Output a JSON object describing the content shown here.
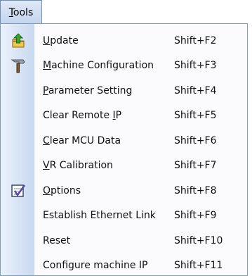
{
  "menu": {
    "title_mnemonic": "T",
    "title_rest": "ools"
  },
  "items": [
    {
      "pre": "",
      "mn": "U",
      "post": "pdate",
      "shortcut": "Shift+F2",
      "icon": "upload-folder-icon"
    },
    {
      "pre": "",
      "mn": "M",
      "post": "achine Configuration",
      "shortcut": "Shift+F3",
      "icon": "hammer-icon"
    },
    {
      "pre": "",
      "mn": "P",
      "post": "arameter Setting",
      "shortcut": "Shift+F4",
      "icon": ""
    },
    {
      "pre": "Clear Remote ",
      "mn": "I",
      "post": "P",
      "shortcut": "Shift+F5",
      "icon": ""
    },
    {
      "pre": "",
      "mn": "C",
      "post": "lear MCU Data",
      "shortcut": "Shift+F6",
      "icon": ""
    },
    {
      "pre": "",
      "mn": "V",
      "post": "R Calibration",
      "shortcut": "Shift+F7",
      "icon": ""
    },
    {
      "pre": "",
      "mn": "O",
      "post": "ptions",
      "shortcut": "Shift+F8",
      "icon": "options-checklist-icon"
    },
    {
      "pre": "Establish Ethernet Link",
      "mn": "",
      "post": "",
      "shortcut": "Shift+F9",
      "icon": ""
    },
    {
      "pre": "Reset",
      "mn": "",
      "post": "",
      "shortcut": "Shift+F10",
      "icon": ""
    },
    {
      "pre": "Configure machine IP",
      "mn": "",
      "post": "",
      "shortcut": "Shift+F11",
      "icon": ""
    }
  ]
}
